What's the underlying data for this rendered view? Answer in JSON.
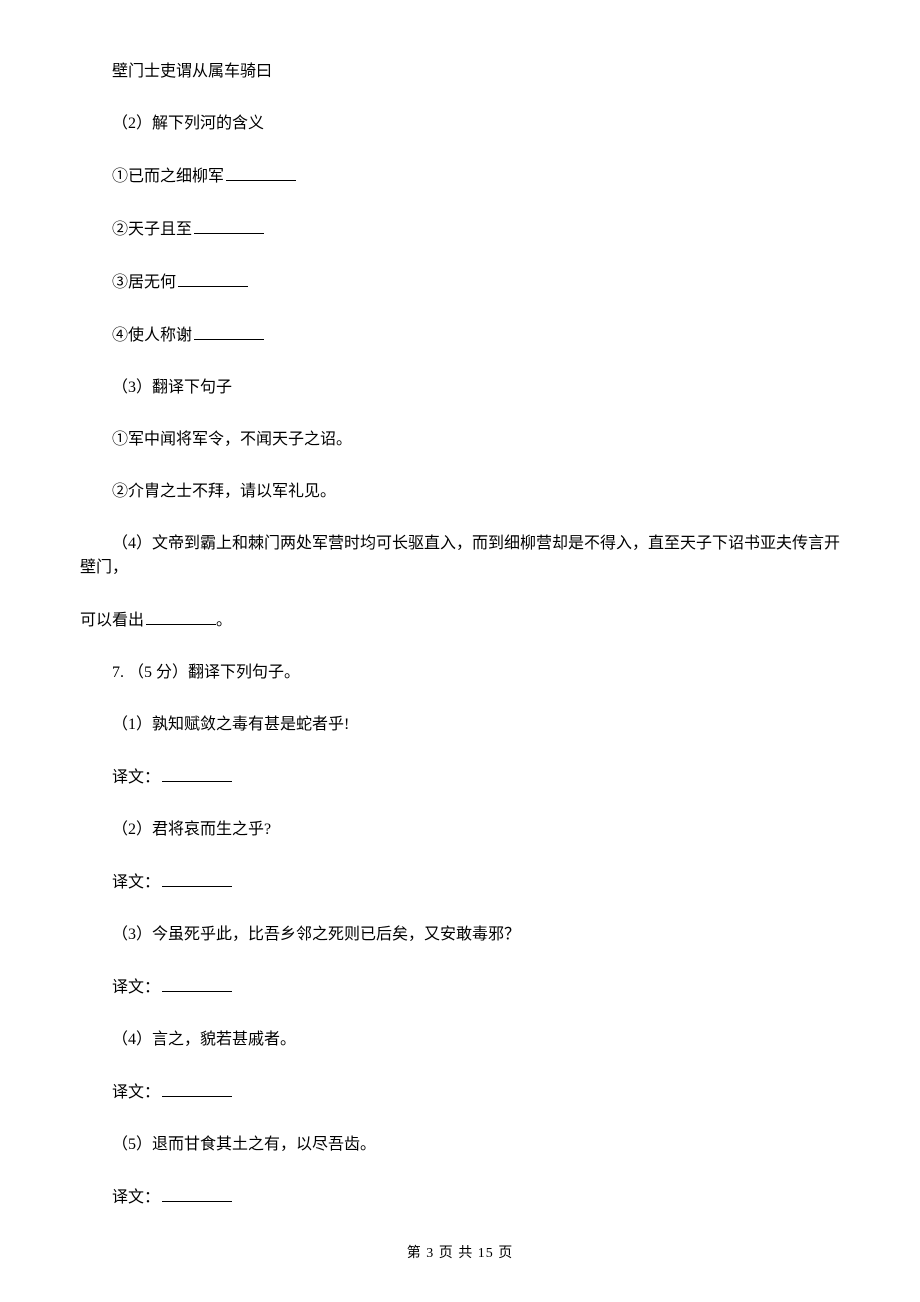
{
  "lines": {
    "l1": "壁门士吏谓从属车骑曰",
    "l2": "（2）解下列河的含义",
    "l3": "①已而之细柳军",
    "l4": "②天子且至",
    "l5": "③居无何",
    "l6": "④使人称谢",
    "l7": "（3）翻译下句子",
    "l8": "①军中闻将军令，不闻天子之诏。",
    "l9": "②介胄之士不拜，请以军礼见。",
    "l10a": "（4）文帝到霸上和棘门两处军营时均可长驱直入，而到细柳营却是不得入，直至天子下诏书亚夫传言开壁门，",
    "l10b": "可以看出",
    "l10c": "。",
    "l11": "7. （5 分）翻译下列句子。",
    "l12": "（1）孰知赋敛之毒有甚是蛇者乎!",
    "l13": "译文：",
    "l14": "（2）君将哀而生之乎?",
    "l15": "译文：",
    "l16": "（3）今虽死乎此，比吾乡邻之死则已后矣，又安敢毒邪？",
    "l17": "译文：",
    "l18": "（4）言之，貌若甚戚者。",
    "l19": "译文：",
    "l20": "（5）退而甘食其土之有，以尽吾齿。",
    "l21": "译文："
  },
  "footer": {
    "prefix": "第 ",
    "current": "3",
    "mid": " 页 共 ",
    "total": "15",
    "suffix": " 页"
  }
}
